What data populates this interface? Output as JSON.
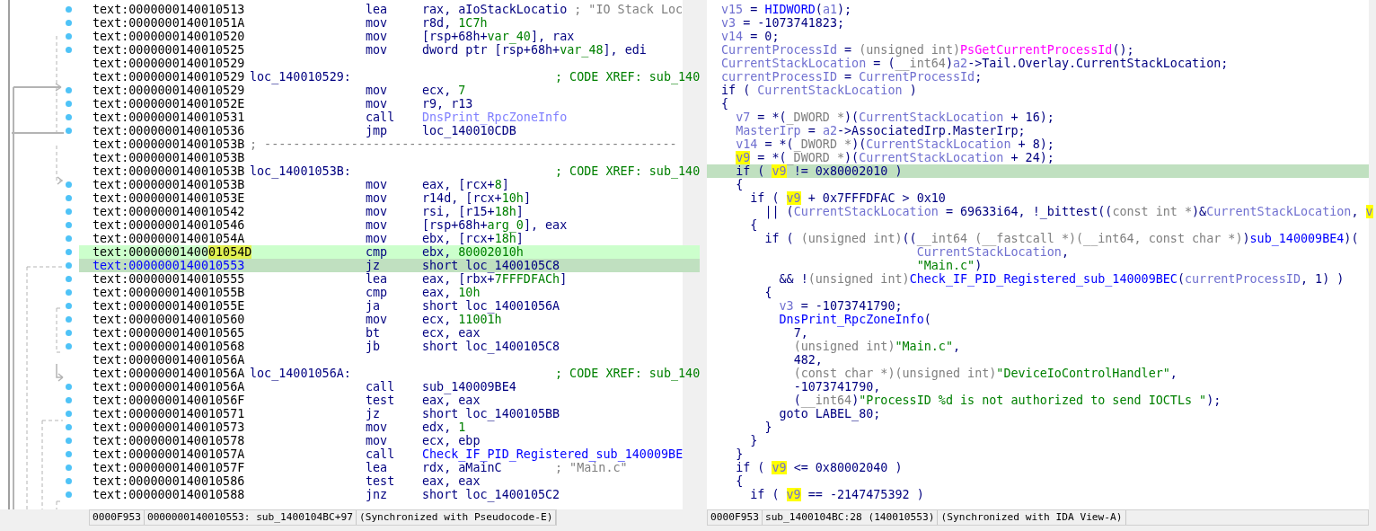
{
  "disassembly": {
    "rows": [
      {
        "address": "text:0000000140010513",
        "mnemonic": "lea",
        "operands": [
          {
            "kind": "t",
            "text": "rax, aIoStackLocatio"
          }
        ],
        "comment": {
          "kind": "string",
          "text": "; \"IO Stack Loc"
        },
        "highlighted": false,
        "selected": false
      },
      {
        "address": "text:000000014001051A",
        "mnemonic": "mov",
        "operands": [
          {
            "kind": "t",
            "text": "r8d, "
          },
          {
            "kind": "num",
            "text": "1C7h"
          }
        ],
        "highlighted": false,
        "selected": false
      },
      {
        "address": "text:0000000140010520",
        "mnemonic": "mov",
        "operands": [
          {
            "kind": "t",
            "text": "[rsp+68h+"
          },
          {
            "kind": "num",
            "text": "var_40"
          },
          {
            "kind": "t",
            "text": "], rax"
          }
        ],
        "highlighted": false,
        "selected": false
      },
      {
        "address": "text:0000000140010525",
        "mnemonic": "mov",
        "operands": [
          {
            "kind": "t",
            "text": "dword ptr [rsp+68h+"
          },
          {
            "kind": "num",
            "text": "var_48"
          },
          {
            "kind": "t",
            "text": "], edi"
          }
        ],
        "highlighted": false,
        "selected": false
      },
      {
        "address": "text:0000000140010529",
        "highlighted": false,
        "selected": false
      },
      {
        "address": "text:0000000140010529",
        "label": "loc_140010529:",
        "comment": {
          "kind": "xref",
          "text": "; CODE XREF: sub_140"
        },
        "highlighted": false,
        "selected": false
      },
      {
        "address": "text:0000000140010529",
        "mnemonic": "mov",
        "operands": [
          {
            "kind": "t",
            "text": "ecx, "
          },
          {
            "kind": "num",
            "text": "7"
          }
        ],
        "highlighted": false,
        "selected": false
      },
      {
        "address": "text:000000014001052E",
        "mnemonic": "mov",
        "operands": [
          {
            "kind": "t",
            "text": "r9, r13"
          }
        ],
        "highlighted": false,
        "selected": false
      },
      {
        "address": "text:0000000140010531",
        "mnemonic": "call",
        "operands": [
          {
            "kind": "imp",
            "text": "DnsPrint_RpcZoneInfo"
          }
        ],
        "highlighted": false,
        "selected": false
      },
      {
        "address": "text:0000000140010536",
        "mnemonic": "jmp",
        "operands": [
          {
            "kind": "t",
            "text": "loc_140010CDB"
          }
        ],
        "highlighted": false,
        "selected": false
      },
      {
        "address": "text:000000014001053B",
        "separator": "; ---------------------------------------------------------",
        "highlighted": false,
        "selected": false
      },
      {
        "address": "text:000000014001053B",
        "highlighted": false,
        "selected": false
      },
      {
        "address": "text:000000014001053B",
        "label": "loc_14001053B:",
        "comment": {
          "kind": "xref",
          "text": "; CODE XREF: sub_140"
        },
        "highlighted": false,
        "selected": false
      },
      {
        "address": "text:000000014001053B",
        "mnemonic": "mov",
        "operands": [
          {
            "kind": "t",
            "text": "eax, [rcx+"
          },
          {
            "kind": "num",
            "text": "8"
          },
          {
            "kind": "t",
            "text": "]"
          }
        ],
        "highlighted": false,
        "selected": false
      },
      {
        "address": "text:000000014001053E",
        "mnemonic": "mov",
        "operands": [
          {
            "kind": "t",
            "text": "r14d, [rcx+"
          },
          {
            "kind": "num",
            "text": "10h"
          },
          {
            "kind": "t",
            "text": "]"
          }
        ],
        "highlighted": false,
        "selected": false
      },
      {
        "address": "text:0000000140010542",
        "mnemonic": "mov",
        "operands": [
          {
            "kind": "t",
            "text": "rsi, [r15+"
          },
          {
            "kind": "num",
            "text": "18h"
          },
          {
            "kind": "t",
            "text": "]"
          }
        ],
        "highlighted": false,
        "selected": false
      },
      {
        "address": "text:0000000140010546",
        "mnemonic": "mov",
        "operands": [
          {
            "kind": "t",
            "text": "[rsp+68h+"
          },
          {
            "kind": "num",
            "text": "arg_0"
          },
          {
            "kind": "t",
            "text": "], eax"
          }
        ],
        "highlighted": false,
        "selected": false
      },
      {
        "address": "text:000000014001054A",
        "mnemonic": "mov",
        "operands": [
          {
            "kind": "t",
            "text": "ebx, [rcx+"
          },
          {
            "kind": "num",
            "text": "18h"
          },
          {
            "kind": "t",
            "text": "]"
          }
        ],
        "highlighted": false,
        "selected": false
      },
      {
        "address": "text:00000001400",
        "address_highlight": "01054D",
        "mnemonic": "cmp",
        "operands": [
          {
            "kind": "t",
            "text": "ebx, "
          },
          {
            "kind": "num",
            "text": "80002010h"
          }
        ],
        "highlighted": true,
        "selected": false
      },
      {
        "address": "text:0000000140010553",
        "mnemonic": "jz",
        "operands": [
          {
            "kind": "t",
            "text": "short loc_1400105C8"
          }
        ],
        "highlighted": false,
        "selected": true
      },
      {
        "address": "text:0000000140010555",
        "mnemonic": "lea",
        "operands": [
          {
            "kind": "t",
            "text": "eax, [rbx+"
          },
          {
            "kind": "num",
            "text": "7FFFDFACh"
          },
          {
            "kind": "t",
            "text": "]"
          }
        ],
        "highlighted": false,
        "selected": false
      },
      {
        "address": "text:000000014001055B",
        "mnemonic": "cmp",
        "operands": [
          {
            "kind": "t",
            "text": "eax, "
          },
          {
            "kind": "num",
            "text": "10h"
          }
        ],
        "highlighted": false,
        "selected": false
      },
      {
        "address": "text:000000014001055E",
        "mnemonic": "ja",
        "operands": [
          {
            "kind": "t",
            "text": "short loc_14001056A"
          }
        ],
        "highlighted": false,
        "selected": false
      },
      {
        "address": "text:0000000140010560",
        "mnemonic": "mov",
        "operands": [
          {
            "kind": "t",
            "text": "ecx, "
          },
          {
            "kind": "num",
            "text": "11001h"
          }
        ],
        "highlighted": false,
        "selected": false
      },
      {
        "address": "text:0000000140010565",
        "mnemonic": "bt",
        "operands": [
          {
            "kind": "t",
            "text": "ecx, eax"
          }
        ],
        "highlighted": false,
        "selected": false
      },
      {
        "address": "text:0000000140010568",
        "mnemonic": "jb",
        "operands": [
          {
            "kind": "t",
            "text": "short loc_1400105C8"
          }
        ],
        "highlighted": false,
        "selected": false
      },
      {
        "address": "text:000000014001056A",
        "highlighted": false,
        "selected": false
      },
      {
        "address": "text:000000014001056A",
        "label": "loc_14001056A:",
        "comment": {
          "kind": "xref",
          "text": "; CODE XREF: sub_140"
        },
        "highlighted": false,
        "selected": false
      },
      {
        "address": "text:000000014001056A",
        "mnemonic": "call",
        "operands": [
          {
            "kind": "t",
            "text": "sub_140009BE4"
          }
        ],
        "highlighted": false,
        "selected": false
      },
      {
        "address": "text:000000014001056F",
        "mnemonic": "test",
        "operands": [
          {
            "kind": "t",
            "text": "eax, eax"
          }
        ],
        "highlighted": false,
        "selected": false
      },
      {
        "address": "text:0000000140010571",
        "mnemonic": "jz",
        "operands": [
          {
            "kind": "t",
            "text": "short loc_1400105BB"
          }
        ],
        "highlighted": false,
        "selected": false
      },
      {
        "address": "text:0000000140010573",
        "mnemonic": "mov",
        "operands": [
          {
            "kind": "t",
            "text": "edx, "
          },
          {
            "kind": "num",
            "text": "1"
          }
        ],
        "highlighted": false,
        "selected": false
      },
      {
        "address": "text:0000000140010578",
        "mnemonic": "mov",
        "operands": [
          {
            "kind": "t",
            "text": "ecx, ebp"
          }
        ],
        "highlighted": false,
        "selected": false
      },
      {
        "address": "text:000000014001057A",
        "mnemonic": "call",
        "operands": [
          {
            "kind": "fn",
            "text": "Check_IF_PID_Registered_sub_140009BE"
          }
        ],
        "highlighted": false,
        "selected": false
      },
      {
        "address": "text:000000014001057F",
        "mnemonic": "lea",
        "operands": [
          {
            "kind": "t",
            "text": "rdx, aMainC"
          }
        ],
        "comment": {
          "kind": "string",
          "text": "; \"Main.c\""
        },
        "highlighted": false,
        "selected": false
      },
      {
        "address": "text:0000000140010586",
        "mnemonic": "test",
        "operands": [
          {
            "kind": "t",
            "text": "eax, eax"
          }
        ],
        "highlighted": false,
        "selected": false
      },
      {
        "address": "text:0000000140010588",
        "mnemonic": "jnz",
        "operands": [
          {
            "kind": "t",
            "text": "short loc_1400105C2"
          }
        ],
        "highlighted": false,
        "selected": false
      }
    ],
    "status_bar": [
      "0000F953",
      "0000000140010553: sub_1400104BC+97",
      "(Synchronized with Pseudocode-E)"
    ]
  },
  "pseudocode": {
    "lines": [
      {
        "selected": false,
        "tokens": [
          {
            "kind": "var",
            "text": "v15"
          },
          {
            "kind": "t",
            "text": " = "
          },
          {
            "kind": "fn",
            "text": "HIDWORD"
          },
          {
            "kind": "t",
            "text": "("
          },
          {
            "kind": "var",
            "text": "a1"
          },
          {
            "kind": "t",
            "text": ");"
          }
        ]
      },
      {
        "selected": false,
        "tokens": [
          {
            "kind": "var",
            "text": "v3"
          },
          {
            "kind": "t",
            "text": " = -1073741823;"
          }
        ]
      },
      {
        "selected": false,
        "tokens": [
          {
            "kind": "var",
            "text": "v14"
          },
          {
            "kind": "t",
            "text": " = 0;"
          }
        ]
      },
      {
        "selected": false,
        "tokens": [
          {
            "kind": "var",
            "text": "CurrentProcessId"
          },
          {
            "kind": "t",
            "text": " = "
          },
          {
            "kind": "type",
            "text": "(unsigned int)"
          },
          {
            "kind": "imp",
            "text": "PsGetCurrentProcessId"
          },
          {
            "kind": "t",
            "text": "();"
          }
        ]
      },
      {
        "selected": false,
        "tokens": [
          {
            "kind": "var",
            "text": "CurrentStackLocation"
          },
          {
            "kind": "t",
            "text": " = ("
          },
          {
            "kind": "type",
            "text": "__int64"
          },
          {
            "kind": "t",
            "text": ")"
          },
          {
            "kind": "var",
            "text": "a2"
          },
          {
            "kind": "t",
            "text": "->Tail.Overlay.CurrentStackLocation;"
          }
        ]
      },
      {
        "selected": false,
        "tokens": [
          {
            "kind": "var",
            "text": "currentProcessID"
          },
          {
            "kind": "t",
            "text": " = "
          },
          {
            "kind": "var",
            "text": "CurrentProcessId"
          },
          {
            "kind": "t",
            "text": ";"
          }
        ]
      },
      {
        "selected": false,
        "tokens": [
          {
            "kind": "t",
            "text": "if ( "
          },
          {
            "kind": "var",
            "text": "CurrentStackLocation"
          },
          {
            "kind": "t",
            "text": " )"
          }
        ]
      },
      {
        "selected": false,
        "tokens": [
          {
            "kind": "t",
            "text": "{"
          }
        ]
      },
      {
        "selected": false,
        "tokens": [
          {
            "kind": "var",
            "text": "  v7"
          },
          {
            "kind": "t",
            "text": " = *("
          },
          {
            "kind": "type",
            "text": "_DWORD *"
          },
          {
            "kind": "t",
            "text": ")("
          },
          {
            "kind": "var",
            "text": "CurrentStackLocation"
          },
          {
            "kind": "t",
            "text": " + 16);"
          }
        ]
      },
      {
        "selected": false,
        "tokens": [
          {
            "kind": "var",
            "text": "  MasterIrp"
          },
          {
            "kind": "t",
            "text": " = "
          },
          {
            "kind": "var",
            "text": "a2"
          },
          {
            "kind": "t",
            "text": "->AssociatedIrp.MasterIrp;"
          }
        ]
      },
      {
        "selected": false,
        "tokens": [
          {
            "kind": "var",
            "text": "  v14"
          },
          {
            "kind": "t",
            "text": " = *("
          },
          {
            "kind": "type",
            "text": "_DWORD *"
          },
          {
            "kind": "t",
            "text": ")("
          },
          {
            "kind": "var",
            "text": "CurrentStackLocation"
          },
          {
            "kind": "t",
            "text": " + 8);"
          }
        ]
      },
      {
        "selected": false,
        "tokens": [
          {
            "kind": "hl",
            "text": "  v9"
          },
          {
            "kind": "t",
            "text": " = *("
          },
          {
            "kind": "type",
            "text": "_DWORD *"
          },
          {
            "kind": "t",
            "text": ")("
          },
          {
            "kind": "var",
            "text": "CurrentStackLocation"
          },
          {
            "kind": "t",
            "text": " + 24);"
          }
        ]
      },
      {
        "selected": true,
        "tokens": [
          {
            "kind": "t",
            "text": "  if ( "
          },
          {
            "kind": "hl",
            "text": "v9"
          },
          {
            "kind": "t",
            "text": " != 0x80002010 )"
          }
        ]
      },
      {
        "selected": false,
        "tokens": [
          {
            "kind": "t",
            "text": "  {"
          }
        ]
      },
      {
        "selected": false,
        "tokens": [
          {
            "kind": "t",
            "text": "    if ( "
          },
          {
            "kind": "hl",
            "text": "v9"
          },
          {
            "kind": "t",
            "text": " + 0x7FFFDFAC > 0x10"
          }
        ]
      },
      {
        "selected": false,
        "tokens": [
          {
            "kind": "t",
            "text": "      || ("
          },
          {
            "kind": "var",
            "text": "CurrentStackLocation"
          },
          {
            "kind": "t",
            "text": " = 69633i64, !_bittest(("
          },
          {
            "kind": "type",
            "text": "const int *"
          },
          {
            "kind": "t",
            "text": ")&"
          },
          {
            "kind": "var",
            "text": "CurrentStackLocation"
          },
          {
            "kind": "t",
            "text": ", "
          },
          {
            "kind": "hl",
            "text": "v"
          }
        ]
      },
      {
        "selected": false,
        "tokens": [
          {
            "kind": "t",
            "text": "    {"
          }
        ]
      },
      {
        "selected": false,
        "tokens": [
          {
            "kind": "t",
            "text": "      if ( "
          },
          {
            "kind": "type",
            "text": "(unsigned int)"
          },
          {
            "kind": "t",
            "text": "(("
          },
          {
            "kind": "type",
            "text": "__int64 (__fastcall *)(__int64, const char *)"
          },
          {
            "kind": "t",
            "text": ")"
          },
          {
            "kind": "fn",
            "text": "sub_140009BE4"
          },
          {
            "kind": "t",
            "text": ")("
          }
        ]
      },
      {
        "selected": false,
        "tokens": [
          {
            "kind": "var",
            "text": "                           CurrentStackLocation"
          },
          {
            "kind": "t",
            "text": ","
          }
        ]
      },
      {
        "selected": false,
        "tokens": [
          {
            "kind": "str",
            "text": "                           \"Main.c\""
          },
          {
            "kind": "t",
            "text": ")"
          }
        ]
      },
      {
        "selected": false,
        "tokens": [
          {
            "kind": "t",
            "text": "        && !"
          },
          {
            "kind": "type",
            "text": "(unsigned int)"
          },
          {
            "kind": "fn",
            "text": "Check_IF_PID_Registered_sub_140009BEC"
          },
          {
            "kind": "t",
            "text": "("
          },
          {
            "kind": "var",
            "text": "currentProcessID"
          },
          {
            "kind": "t",
            "text": ", 1) )"
          }
        ]
      },
      {
        "selected": false,
        "tokens": [
          {
            "kind": "t",
            "text": "      {"
          }
        ]
      },
      {
        "selected": false,
        "tokens": [
          {
            "kind": "var",
            "text": "        v3"
          },
          {
            "kind": "t",
            "text": " = -1073741790;"
          }
        ]
      },
      {
        "selected": false,
        "tokens": [
          {
            "kind": "fn",
            "text": "        DnsPrint_RpcZoneInfo"
          },
          {
            "kind": "t",
            "text": "("
          }
        ]
      },
      {
        "selected": false,
        "tokens": [
          {
            "kind": "t",
            "text": "          7,"
          }
        ]
      },
      {
        "selected": false,
        "tokens": [
          {
            "kind": "type",
            "text": "          (unsigned int)"
          },
          {
            "kind": "str",
            "text": "\"Main.c\""
          },
          {
            "kind": "t",
            "text": ","
          }
        ]
      },
      {
        "selected": false,
        "tokens": [
          {
            "kind": "t",
            "text": "          482,"
          }
        ]
      },
      {
        "selected": false,
        "tokens": [
          {
            "kind": "type",
            "text": "          (const char *)(unsigned int)"
          },
          {
            "kind": "str",
            "text": "\"DeviceIoControlHandler\""
          },
          {
            "kind": "t",
            "text": ","
          }
        ]
      },
      {
        "selected": false,
        "tokens": [
          {
            "kind": "t",
            "text": "          -1073741790,"
          }
        ]
      },
      {
        "selected": false,
        "tokens": [
          {
            "kind": "t",
            "text": "          ("
          },
          {
            "kind": "type",
            "text": "__int64"
          },
          {
            "kind": "t",
            "text": ")"
          },
          {
            "kind": "str",
            "text": "\"ProcessID %d is not authorized to send IOCTLs \""
          },
          {
            "kind": "t",
            "text": ");"
          }
        ]
      },
      {
        "selected": false,
        "tokens": [
          {
            "kind": "t",
            "text": "        goto LABEL_80;"
          }
        ]
      },
      {
        "selected": false,
        "tokens": [
          {
            "kind": "t",
            "text": "      }"
          }
        ]
      },
      {
        "selected": false,
        "tokens": [
          {
            "kind": "t",
            "text": "    }"
          }
        ]
      },
      {
        "selected": false,
        "tokens": [
          {
            "kind": "t",
            "text": "  }"
          }
        ]
      },
      {
        "selected": false,
        "tokens": [
          {
            "kind": "t",
            "text": "  if ( "
          },
          {
            "kind": "hl",
            "text": "v9"
          },
          {
            "kind": "t",
            "text": " <= 0x80002040 )"
          }
        ]
      },
      {
        "selected": false,
        "tokens": [
          {
            "kind": "t",
            "text": "  {"
          }
        ]
      },
      {
        "selected": false,
        "tokens": [
          {
            "kind": "t",
            "text": "    if ( "
          },
          {
            "kind": "hl",
            "text": "v9"
          },
          {
            "kind": "t",
            "text": " == -2147475392 )"
          }
        ]
      }
    ],
    "status_bar": [
      "0000F953",
      "sub_1400104BC:28 (140010553)",
      "(Synchronized with IDA View-A)"
    ]
  }
}
